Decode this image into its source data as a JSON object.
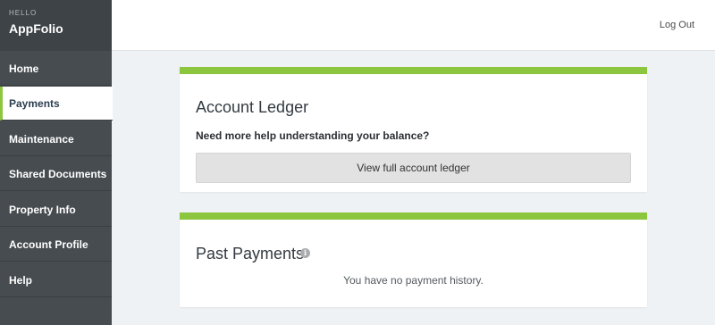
{
  "brand": {
    "greeting": "HELLO",
    "name": "AppFolio"
  },
  "nav": {
    "items": [
      {
        "label": "Home"
      },
      {
        "label": "Payments"
      },
      {
        "label": "Maintenance"
      },
      {
        "label": "Shared Documents"
      },
      {
        "label": "Property Info"
      },
      {
        "label": "Account Profile"
      },
      {
        "label": "Help"
      }
    ],
    "active": "Payments"
  },
  "header": {
    "logout_label": "Log Out"
  },
  "ledger": {
    "title": "Account Ledger",
    "help_text": "Need more help understanding your balance?",
    "button_label": "View full account ledger"
  },
  "payments": {
    "title": "Past Payments",
    "info_icon": "info-icon",
    "empty_text": "You have no payment history."
  },
  "colors": {
    "accent": "#8cc63f",
    "sidebar": "#474c50",
    "background": "#eef2f4"
  }
}
